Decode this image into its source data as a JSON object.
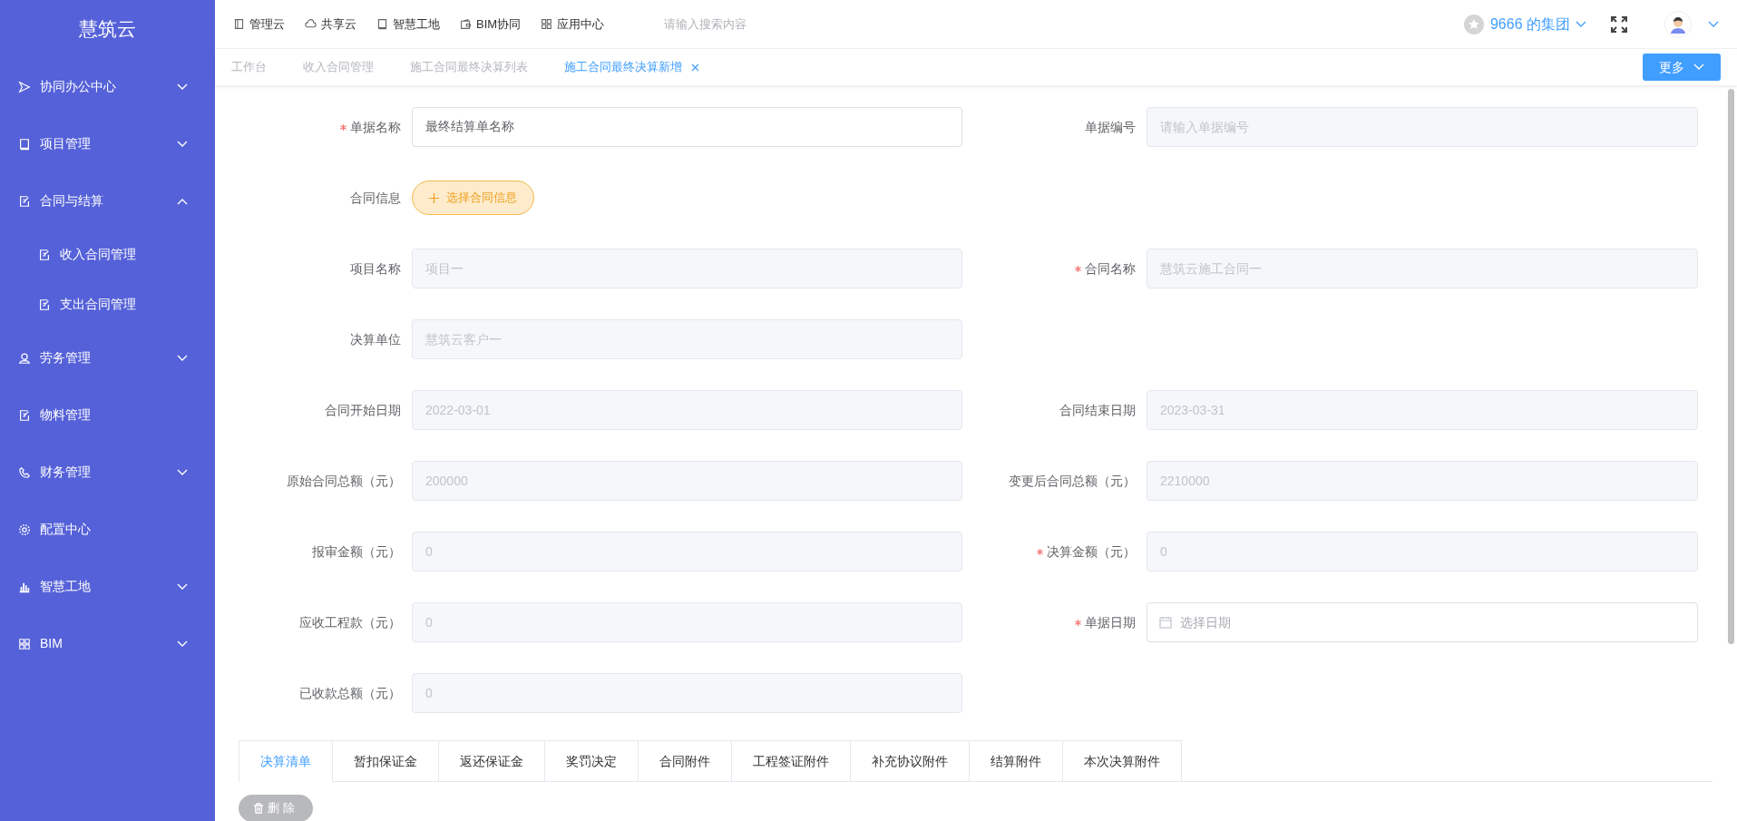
{
  "sidebar": {
    "logo": "慧筑云",
    "items": [
      {
        "label": "协同办公中心",
        "kind": "send",
        "expanded": false
      },
      {
        "label": "项目管理",
        "kind": "book",
        "expanded": false
      },
      {
        "label": "合同与结算",
        "kind": "edit",
        "expanded": true,
        "children": [
          {
            "label": "收入合同管理",
            "kind": "edit"
          },
          {
            "label": "支出合同管理",
            "kind": "edit"
          }
        ]
      },
      {
        "label": "劳务管理",
        "kind": "user",
        "expanded": false
      },
      {
        "label": "物料管理",
        "kind": "edit"
      },
      {
        "label": "财务管理",
        "kind": "phone",
        "expanded": false
      },
      {
        "label": "配置中心",
        "kind": "gear"
      },
      {
        "label": "智慧工地",
        "kind": "bars",
        "expanded": false
      },
      {
        "label": "BIM",
        "kind": "grid",
        "expanded": false
      }
    ]
  },
  "top_nav": {
    "items": [
      {
        "label": "管理云",
        "kind": "panel"
      },
      {
        "label": "共享云",
        "kind": "cloud"
      },
      {
        "label": "智慧工地",
        "kind": "book"
      },
      {
        "label": "BIM协同",
        "kind": "wallet"
      },
      {
        "label": "应用中心",
        "kind": "grid"
      }
    ],
    "search": {
      "placeholder": "请输入搜索内容"
    },
    "organization": "9666 的集团"
  },
  "page_tabs": [
    {
      "label": "工作台",
      "selected": false,
      "closable": false
    },
    {
      "label": "收入合同管理",
      "selected": false,
      "closable": false
    },
    {
      "label": "施工合同最终决算列表",
      "selected": false,
      "closable": false
    },
    {
      "label": "施工合同最终决算新增",
      "selected": true,
      "closable": true
    }
  ],
  "more_button": "更多",
  "form_rows": [
    {
      "left": {
        "kind": "input",
        "label": "单据名称",
        "required": true,
        "value": "最终结算单名称",
        "disabled": false
      },
      "right": {
        "kind": "input",
        "label": "单据编号",
        "required": false,
        "placeholder": "请输入单据编号",
        "disabled": true
      }
    },
    {
      "left": {
        "kind": "button",
        "label": "合同信息",
        "required": false,
        "button": "选择合同信息"
      }
    },
    {
      "left": {
        "kind": "input",
        "label": "项目名称",
        "required": false,
        "placeholder": "项目一",
        "disabled": true
      },
      "right": {
        "kind": "input",
        "label": "合同名称",
        "required": true,
        "placeholder": "慧筑云施工合同一",
        "disabled": true
      }
    },
    {
      "left": {
        "kind": "input",
        "label": "决算单位",
        "required": false,
        "placeholder": "慧筑云客户一",
        "disabled": true
      }
    },
    {
      "left": {
        "kind": "input",
        "label": "合同开始日期",
        "required": false,
        "placeholder": "2022-03-01",
        "disabled": true
      },
      "right": {
        "kind": "input",
        "label": "合同结束日期",
        "required": false,
        "placeholder": "2023-03-31",
        "disabled": true
      }
    },
    {
      "left": {
        "kind": "input",
        "label": "原始合同总额（元）",
        "required": false,
        "placeholder": "200000",
        "disabled": true
      },
      "right": {
        "kind": "input",
        "label": "变更后合同总额（元）",
        "required": false,
        "placeholder": "2210000",
        "disabled": true
      }
    },
    {
      "left": {
        "kind": "input",
        "label": "报审金额（元）",
        "required": false,
        "placeholder": "0",
        "disabled": true
      },
      "right": {
        "kind": "input",
        "label": "决算金额（元）",
        "required": true,
        "placeholder": "0",
        "disabled": true
      }
    },
    {
      "left": {
        "kind": "input",
        "label": "应收工程款（元）",
        "required": false,
        "placeholder": "0",
        "disabled": true
      },
      "right": {
        "kind": "date",
        "label": "单据日期",
        "required": true,
        "placeholder": "选择日期",
        "disabled": false
      }
    },
    {
      "left": {
        "kind": "input",
        "label": "已收款总额（元）",
        "required": false,
        "placeholder": "0",
        "disabled": true
      }
    }
  ],
  "detail_tabs": [
    {
      "label": "决算清单",
      "selected": true
    },
    {
      "label": "暂扣保证金",
      "selected": false
    },
    {
      "label": "返还保证金",
      "selected": false
    },
    {
      "label": "奖罚决定",
      "selected": false
    },
    {
      "label": "合同附件",
      "selected": false
    },
    {
      "label": "工程签证附件",
      "selected": false
    },
    {
      "label": "补充协议附件",
      "selected": false
    },
    {
      "label": "结算附件",
      "selected": false
    },
    {
      "label": "本次决算附件",
      "selected": false
    }
  ],
  "delete_button": {
    "label": "删除",
    "disabled": true
  }
}
